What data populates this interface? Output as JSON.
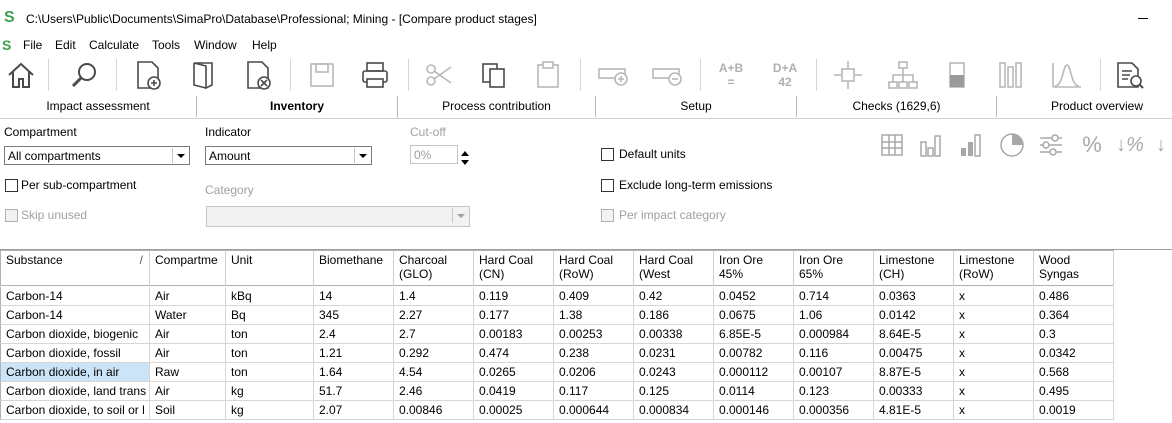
{
  "window": {
    "title": "C:\\Users\\Public\\Documents\\SimaPro\\Database\\Professional; Mining - [Compare product stages]",
    "minimize_label": "–"
  },
  "menu": [
    "File",
    "Edit",
    "Calculate",
    "Tools",
    "Window",
    "Help"
  ],
  "toolbar": {
    "icons": [
      "home-icon",
      "search-icon",
      "new-document-icon",
      "open-folder-icon",
      "close-document-icon",
      "save-icon",
      "print-icon",
      "cut-icon",
      "copy-icon",
      "paste-icon",
      "add-calc-icon",
      "subtract-calc-icon",
      "compare-a-b-icon",
      "d-a-42-icon",
      "network-icon",
      "tree-icon",
      "single-score-icon",
      "bar-chart-icon",
      "distribution-icon",
      "report-icon"
    ],
    "ab_text": "A+B",
    "ab_sub": "=",
    "da_text": "D+A",
    "da_sub": "42"
  },
  "tabs": [
    {
      "label": "Impact assessment",
      "active": false
    },
    {
      "label": "Inventory",
      "active": true
    },
    {
      "label": "Process contribution",
      "active": false
    },
    {
      "label": "Setup",
      "active": false
    },
    {
      "label": "Checks (1629,6)",
      "active": false
    },
    {
      "label": "Product overview",
      "active": false
    }
  ],
  "controls": {
    "compartment_label": "Compartment",
    "compartment_value": "All compartments",
    "indicator_label": "Indicator",
    "indicator_value": "Amount",
    "cutoff_label": "Cut-off",
    "cutoff_value": "0%",
    "default_units": "Default units",
    "per_sub_compartment": "Per sub-compartment",
    "category_label": "Category",
    "exclude_long_term": "Exclude long-term emissions",
    "skip_unused": "Skip unused",
    "per_impact_category": "Per impact category"
  },
  "table": {
    "headers": [
      "Substance",
      "Compartme",
      "Unit",
      "Biomethane",
      "Charcoal (GLO)",
      "Hard Coal (CN)",
      "Hard Coal (RoW)",
      "Hard Coal (West",
      "Iron Ore 45%",
      "Iron Ore 65%",
      "Limestone (CH)",
      "Limestone (RoW)",
      "Wood Syngas"
    ],
    "sort_indicator": "/",
    "rows": [
      [
        "Carbon-14",
        "Air",
        "kBq",
        "14",
        "1.4",
        "0.119",
        "0.409",
        "0.42",
        "0.0452",
        "0.714",
        "0.0363",
        "x",
        "0.486"
      ],
      [
        "Carbon-14",
        "Water",
        "Bq",
        "345",
        "2.27",
        "0.177",
        "1.38",
        "0.186",
        "0.0675",
        "1.06",
        "0.0142",
        "x",
        "0.364"
      ],
      [
        "Carbon dioxide, biogenic",
        "Air",
        "ton",
        "2.4",
        "2.7",
        "0.00183",
        "0.00253",
        "0.00338",
        "6.85E-5",
        "0.000984",
        "8.64E-5",
        "x",
        "0.3"
      ],
      [
        "Carbon dioxide, fossil",
        "Air",
        "ton",
        "1.21",
        "0.292",
        "0.474",
        "0.238",
        "0.0231",
        "0.00782",
        "0.116",
        "0.00475",
        "x",
        "0.0342"
      ],
      [
        "Carbon dioxide, in air",
        "Raw",
        "ton",
        "1.64",
        "4.54",
        "0.0265",
        "0.0206",
        "0.0243",
        "0.000112",
        "0.00107",
        "8.87E-5",
        "x",
        "0.568"
      ],
      [
        "Carbon dioxide, land trans",
        "Air",
        "kg",
        "51.7",
        "2.46",
        "0.0419",
        "0.117",
        "0.125",
        "0.0114",
        "0.123",
        "0.00333",
        "x",
        "0.495"
      ],
      [
        "Carbon dioxide, to soil or l",
        "Soil",
        "kg",
        "2.07",
        "0.00846",
        "0.00025",
        "0.000644",
        "0.000834",
        "0.000146",
        "0.000356",
        "4.81E-5",
        "x",
        "0.0019"
      ]
    ],
    "selected_row": 4
  }
}
